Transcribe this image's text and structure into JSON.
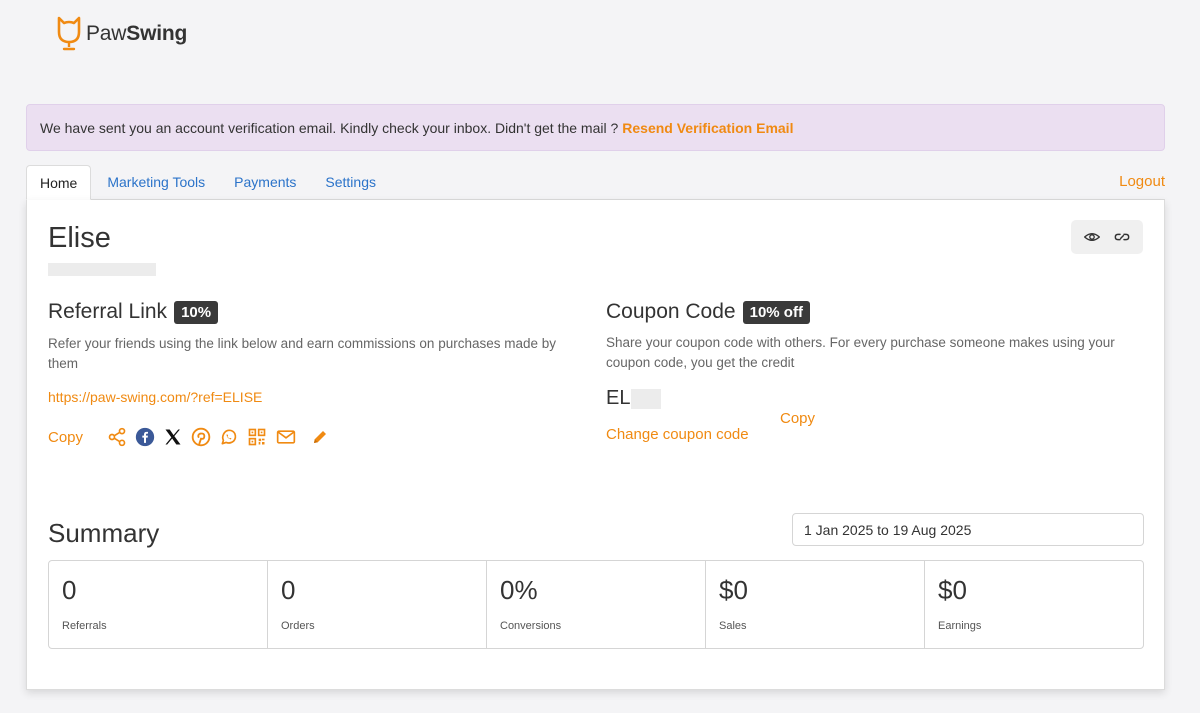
{
  "brand": {
    "name_part1": "Paw",
    "name_part2": "Swing"
  },
  "banner": {
    "message": "We have sent you an account verification email. Kindly check your inbox. Didn't get the mail ?",
    "action": "Resend Verification Email"
  },
  "tabs": [
    {
      "label": "Home",
      "active": true
    },
    {
      "label": "Marketing Tools",
      "active": false
    },
    {
      "label": "Payments",
      "active": false
    },
    {
      "label": "Settings",
      "active": false
    }
  ],
  "logout_label": "Logout",
  "user": {
    "name": "Elise"
  },
  "referral": {
    "title": "Referral Link",
    "badge": "10%",
    "description": "Refer your friends using the link below and earn commissions on purchases made by them",
    "url": "https://paw-swing.com/?ref=ELISE",
    "copy_label": "Copy"
  },
  "coupon": {
    "title": "Coupon Code",
    "badge": "10% off",
    "description": "Share your coupon code with others. For every purchase someone makes using your coupon code, you get the credit",
    "code_visible": "EL",
    "change_label": "Change coupon code",
    "copy_label": "Copy"
  },
  "summary": {
    "title": "Summary",
    "date_range": "1 Jan 2025 to 19 Aug 2025",
    "stats": [
      {
        "value": "0",
        "label": "Referrals"
      },
      {
        "value": "0",
        "label": "Orders"
      },
      {
        "value": "0%",
        "label": "Conversions"
      },
      {
        "value": "$0",
        "label": "Sales"
      },
      {
        "value": "$0",
        "label": "Earnings"
      }
    ]
  },
  "colors": {
    "accent": "#f08a12",
    "link": "#2b73c9",
    "banner_bg": "#ebdff1",
    "badge_bg": "#3a3a3a",
    "facebook": "#3b5998"
  }
}
